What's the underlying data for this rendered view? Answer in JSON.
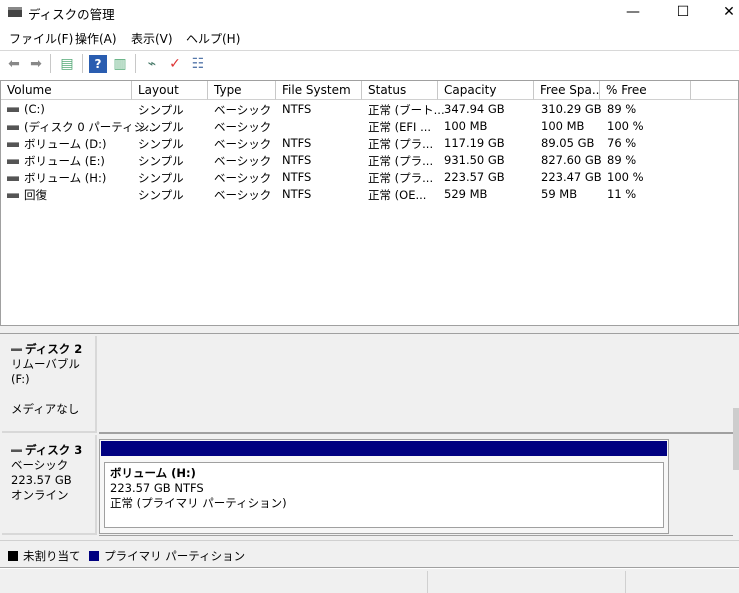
{
  "window": {
    "title": "ディスクの管理",
    "minimize": "—",
    "maximize": "☐",
    "close": "✕"
  },
  "menu": [
    "ファイル(F)",
    "操作(A)",
    "表示(V)",
    "ヘルプ(H)"
  ],
  "toolbar": [
    "back-icon",
    "forward-icon",
    "show-hide-console-tree-icon",
    "help-icon",
    "show-hide-action-pane-icon",
    "connect-disk-icon",
    "checklist-icon",
    "properties-icon"
  ],
  "columns": [
    "Volume",
    "Layout",
    "Type",
    "File System",
    "Status",
    "Capacity",
    "Free Spa...",
    "% Free"
  ],
  "volumes": [
    [
      "(C:)",
      "シンプル",
      "ベーシック",
      "NTFS",
      "正常 (ブート...",
      "347.94 GB",
      "310.29 GB",
      "89 %"
    ],
    [
      "(ディスク 0 パーティシ...",
      "シンプル",
      "ベーシック",
      "",
      "正常 (EFI ...",
      "100 MB",
      "100 MB",
      "100 %"
    ],
    [
      "ボリューム (D:)",
      "シンプル",
      "ベーシック",
      "NTFS",
      "正常 (プラ...",
      "117.19 GB",
      "89.05 GB",
      "76 %"
    ],
    [
      "ボリューム (E:)",
      "シンプル",
      "ベーシック",
      "NTFS",
      "正常 (プラ...",
      "931.50 GB",
      "827.60 GB",
      "89 %"
    ],
    [
      "ボリューム (H:)",
      "シンプル",
      "ベーシック",
      "NTFS",
      "正常 (プラ...",
      "223.57 GB",
      "223.47 GB",
      "100 %"
    ],
    [
      "回復",
      "シンプル",
      "ベーシック",
      "NTFS",
      "正常 (OE...",
      "529 MB",
      "59 MB",
      "11 %"
    ]
  ],
  "disks": [
    {
      "name": "ディスク 2",
      "line1": "リムーバブル (F:)",
      "line2": "メディアなし"
    },
    {
      "name": "ディスク 3",
      "line1": "ベーシック",
      "line2": "223.57 GB",
      "line3": "オンライン",
      "partition": {
        "title": "ボリューム  (H:)",
        "size": "223.57 GB NTFS",
        "status": "正常 (プライマリ パーティション)"
      }
    }
  ],
  "legend": {
    "unallocated": "未割り当て",
    "primary": "プライマリ パーティション"
  },
  "colors": {
    "primary": "#000080",
    "unallocated": "#000000"
  }
}
